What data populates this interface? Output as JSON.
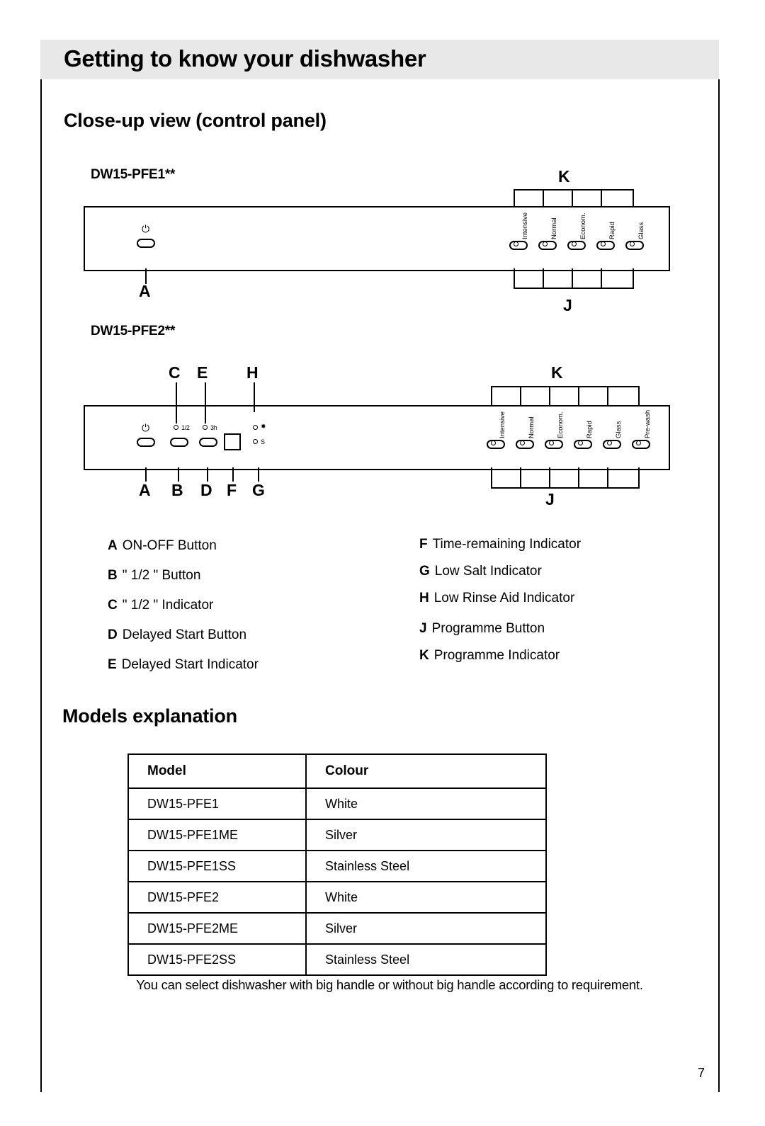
{
  "header": {
    "title": "Getting to know your dishwasher"
  },
  "sections": {
    "close_up": "Close-up view (control panel)",
    "models": "Models explanation"
  },
  "models_shown": {
    "model1": "DW15-PFE1**",
    "model2": "DW15-PFE2**"
  },
  "callouts": {
    "A": "A",
    "B": "B",
    "C": "C",
    "D": "D",
    "E": "E",
    "F": "F",
    "G": "G",
    "H": "H",
    "J": "J",
    "K": "K"
  },
  "panel1": {
    "power_symbol": "⏻",
    "programme_labels": [
      "Intensive",
      "Normal",
      "Econom.",
      "Rapid",
      "Glass"
    ]
  },
  "panel2": {
    "power_symbol": "⏻",
    "half_label": "1/2",
    "delay_label": "3h",
    "time_label": "",
    "salt_rinse_label": "✸",
    "programme_labels": [
      "Intensive",
      "Normal",
      "Econom.",
      "Rapid",
      "Glass",
      "Pre-wash"
    ]
  },
  "legend": {
    "left": [
      {
        "key": "A",
        "text": "ON-OFF Button"
      },
      {
        "key": "B",
        "text": "\" 1/2 \" Button"
      },
      {
        "key": "C",
        "text": "\" 1/2 \" Indicator"
      },
      {
        "key": "D",
        "text": "Delayed Start Button"
      },
      {
        "key": "E",
        "text": "Delayed Start Indicator"
      }
    ],
    "right": [
      {
        "key": "F",
        "text": "Time-remaining Indicator"
      },
      {
        "key": "G",
        "text": "Low Salt Indicator"
      },
      {
        "key": "H",
        "text": "Low Rinse Aid Indicator"
      },
      {
        "key": "J",
        "text": "Programme Button"
      },
      {
        "key": "K",
        "text": "Programme Indicator"
      }
    ]
  },
  "table": {
    "headers": [
      "Model",
      "Colour"
    ],
    "rows": [
      [
        "DW15-PFE1",
        "White"
      ],
      [
        "DW15-PFE1ME",
        "Silver"
      ],
      [
        "DW15-PFE1SS",
        "Stainless Steel"
      ],
      [
        "DW15-PFE2",
        "White"
      ],
      [
        "DW15-PFE2ME",
        "Silver"
      ],
      [
        "DW15-PFE2SS",
        "Stainless Steel"
      ]
    ]
  },
  "footnote": "You can select dishwasher with big handle or without big handle  according to requirement.",
  "page_number": "7"
}
